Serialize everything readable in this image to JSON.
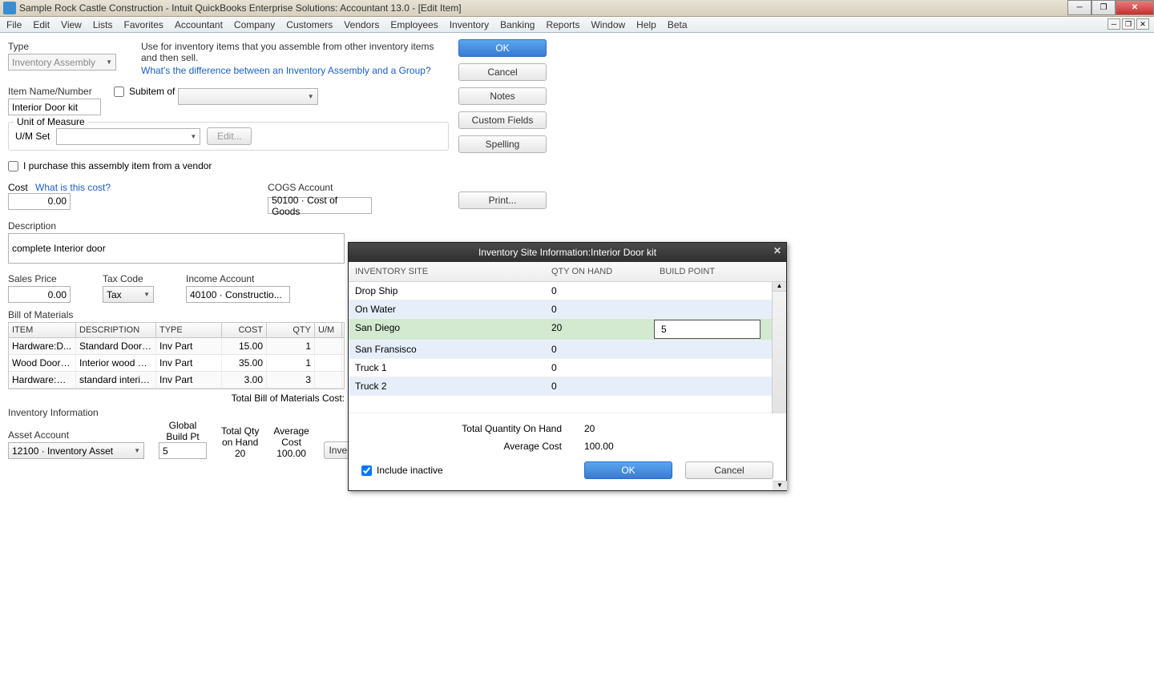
{
  "window": {
    "title": "Sample Rock Castle Construction  - Intuit QuickBooks Enterprise Solutions: Accountant 13.0 - [Edit Item]"
  },
  "menu": [
    "File",
    "Edit",
    "View",
    "Lists",
    "Favorites",
    "Accountant",
    "Company",
    "Customers",
    "Vendors",
    "Employees",
    "Inventory",
    "Banking",
    "Reports",
    "Window",
    "Help",
    "Beta"
  ],
  "form": {
    "type_label": "Type",
    "type_value": "Inventory Assembly",
    "type_help": "Use for inventory items that you assemble from other inventory items and then sell.",
    "type_link": "What's the difference between an Inventory Assembly and a Group?",
    "item_label": "Item Name/Number",
    "item_value": "Interior Door kit",
    "subitem_label": "Subitem of",
    "uom_box_title": "Unit of Measure",
    "uom_label": "U/M Set",
    "uom_edit": "Edit...",
    "purchase_chk": "I purchase this assembly item from a vendor",
    "cost_label": "Cost",
    "cost_link": "What is this cost?",
    "cost_value": "0.00",
    "cogs_label": "COGS Account",
    "cogs_value": "50100 · Cost of Goods",
    "desc_label": "Description",
    "desc_value": "complete Interior door",
    "salesprice_label": "Sales Price",
    "salesprice_value": "0.00",
    "taxcode_label": "Tax Code",
    "taxcode_value": "Tax",
    "income_label": "Income Account",
    "income_value": "40100 · Constructio...",
    "bom_label": "Bill of Materials",
    "bom_headers": {
      "item": "ITEM",
      "desc": "DESCRIPTION",
      "type": "TYPE",
      "cost": "COST",
      "qty": "QTY",
      "um": "U/M"
    },
    "bom_rows": [
      {
        "item": "Hardware:D...",
        "desc": "Standard Doork...",
        "type": "Inv Part",
        "cost": "15.00",
        "qty": "1",
        "um": ""
      },
      {
        "item": "Wood Door:I...",
        "desc": "Interior wood door",
        "type": "Inv Part",
        "cost": "35.00",
        "qty": "1",
        "um": ""
      },
      {
        "item": "Hardware:Br...",
        "desc": "standard interior...",
        "type": "Inv Part",
        "cost": "3.00",
        "qty": "3",
        "um": ""
      }
    ],
    "bom_total_label": "Total Bill of Materials Cost:",
    "invinfo_label": "Inventory Information",
    "asset_label": "Asset Account",
    "asset_value": "12100 · Inventory Asset",
    "global_bp_label1": "Global",
    "global_bp_label2": "Build Pt",
    "global_bp_value": "5",
    "totalqty_label1": "Total Qty",
    "totalqty_label2": "on Hand",
    "totalqty_value": "20",
    "avgcost_label1": "Average",
    "avgcost_label2": "Cost",
    "avgcost_value": "100.00",
    "siteinfo_btn": "Inventory Site Info"
  },
  "buttons": {
    "ok": "OK",
    "cancel": "Cancel",
    "notes": "Notes",
    "custom": "Custom Fields",
    "spelling": "Spelling",
    "print": "Print..."
  },
  "modal": {
    "title": "Inventory Site Information:Interior Door kit",
    "headers": {
      "site": "INVENTORY SITE",
      "qty": "QTY ON HAND",
      "bp": "BUILD POINT"
    },
    "rows": [
      {
        "site": "Drop Ship",
        "qty": "0",
        "bp": ""
      },
      {
        "site": "On Water",
        "qty": "0",
        "bp": ""
      },
      {
        "site": "San Diego",
        "qty": "20",
        "bp": "5"
      },
      {
        "site": "San Fransisco",
        "qty": "0",
        "bp": ""
      },
      {
        "site": "Truck 1",
        "qty": "0",
        "bp": ""
      },
      {
        "site": "Truck 2",
        "qty": "0",
        "bp": ""
      }
    ],
    "totalqty_label": "Total Quantity On Hand",
    "totalqty_value": "20",
    "avgcost_label": "Average Cost",
    "avgcost_value": "100.00",
    "include_label": "Include inactive",
    "ok": "OK",
    "cancel": "Cancel"
  }
}
